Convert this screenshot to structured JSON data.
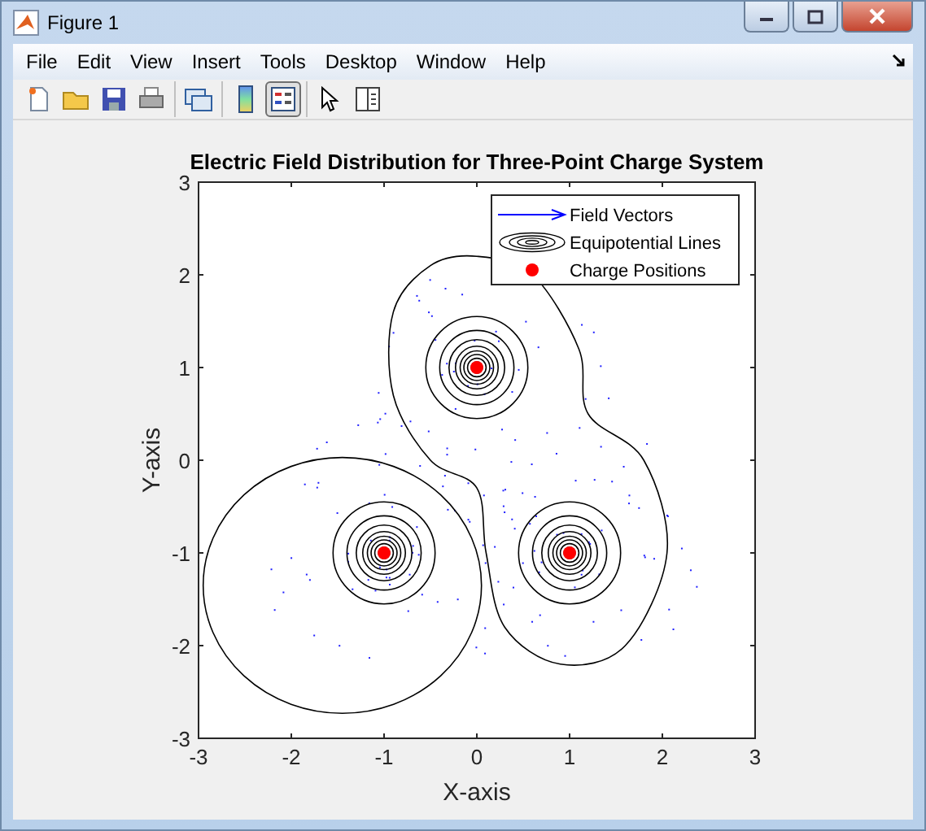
{
  "window": {
    "title": "Figure 1"
  },
  "menu": [
    "File",
    "Edit",
    "View",
    "Insert",
    "Tools",
    "Desktop",
    "Window",
    "Help"
  ],
  "toolbar": [
    [
      {
        "kind": "new",
        "pressed": false
      },
      {
        "kind": "open",
        "pressed": false
      },
      {
        "kind": "save",
        "pressed": false
      },
      {
        "kind": "print",
        "pressed": false
      }
    ],
    [
      {
        "kind": "link",
        "pressed": false
      }
    ],
    [
      {
        "kind": "colorbar",
        "pressed": false
      },
      {
        "kind": "legend",
        "pressed": true
      }
    ],
    [
      {
        "kind": "pointer",
        "pressed": false
      },
      {
        "kind": "panel",
        "pressed": false
      }
    ]
  ],
  "plot": {
    "legend": [
      {
        "kind": "arrow",
        "label": "Field Vectors"
      },
      {
        "kind": "contour",
        "label": "Equipotential Lines"
      },
      {
        "kind": "dot"
      }
    ],
    "chart_data": {
      "type": "scatter",
      "title": "Electric Field Distribution for Three-Point Charge System",
      "xlabel": "X-axis",
      "ylabel": "Y-axis",
      "x": [
        0,
        -1,
        1
      ],
      "series": [
        {
          "name": "Charge Positions",
          "color": "#ff0000",
          "values": [
            1,
            -1,
            -1
          ]
        }
      ],
      "xlim": [
        -3,
        3
      ],
      "ylim": [
        -3,
        3
      ],
      "xticks": [
        -3,
        -2,
        -1,
        0,
        1,
        2,
        3
      ],
      "yticks": [
        -3,
        -2,
        -1,
        0,
        1,
        2,
        3
      ]
    }
  }
}
